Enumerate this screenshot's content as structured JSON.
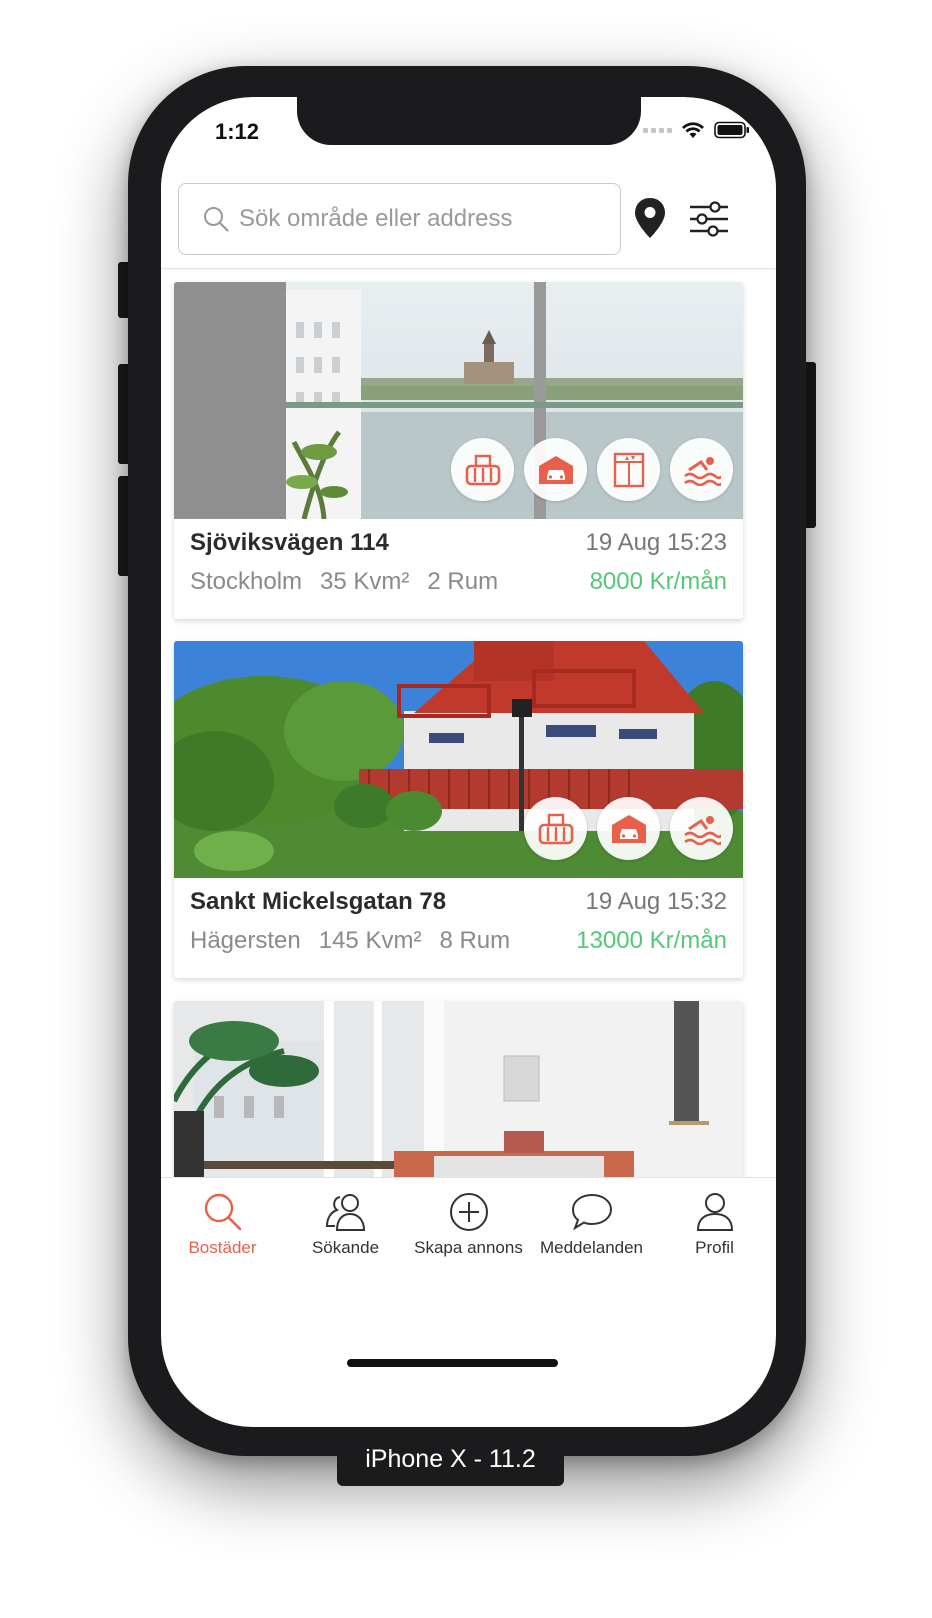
{
  "status_bar": {
    "time": "1:12"
  },
  "search": {
    "placeholder": "Sök område eller address",
    "value": ""
  },
  "listings": [
    {
      "address": "Sjöviksvägen 114",
      "date": "19 Aug 15:23",
      "city": "Stockholm",
      "size": "35 Kvm²",
      "rooms": "2 Rum",
      "price": "8000 Kr/mån",
      "amenities": [
        "balcony-icon",
        "garage-icon",
        "elevator-icon",
        "pool-icon"
      ]
    },
    {
      "address": "Sankt Mickelsgatan 78",
      "date": "19 Aug 15:32",
      "city": "Hägersten",
      "size": "145 Kvm²",
      "rooms": "8 Rum",
      "price": "13000 Kr/mån",
      "amenities": [
        "balcony-icon",
        "garage-icon",
        "pool-icon"
      ]
    }
  ],
  "tabs": [
    {
      "label": "Bostäder",
      "icon": "search-icon",
      "active": true
    },
    {
      "label": "Sökande",
      "icon": "users-icon",
      "active": false
    },
    {
      "label": "Skapa annons",
      "icon": "plus-circle-icon",
      "active": false
    },
    {
      "label": "Meddelanden",
      "icon": "chat-icon",
      "active": false
    },
    {
      "label": "Profil",
      "icon": "user-icon",
      "active": false
    }
  ],
  "device_label": "iPhone X - 11.2",
  "colors": {
    "accent": "#e8604c",
    "price_green": "#55c878",
    "frame": "#1b1b1d"
  }
}
